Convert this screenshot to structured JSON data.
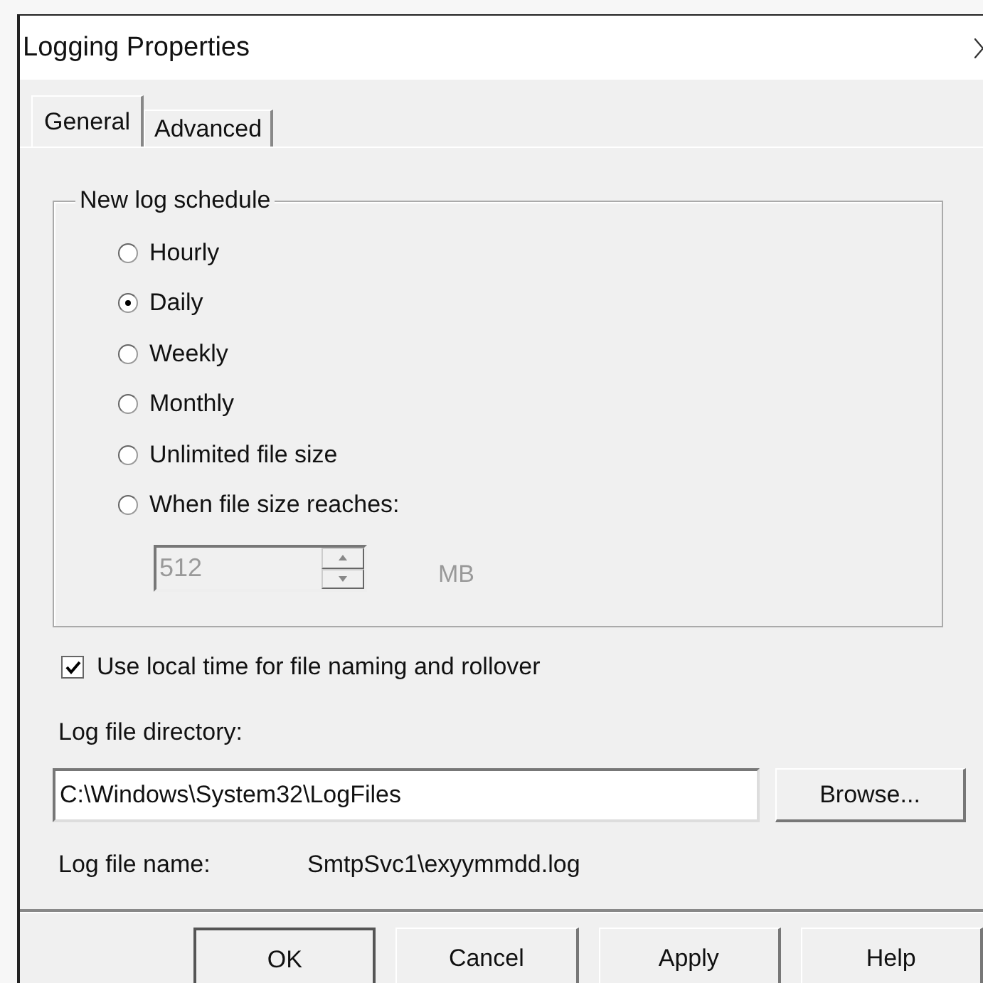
{
  "window": {
    "title": "Logging Properties"
  },
  "tabs": [
    {
      "label": "General",
      "selected": true
    },
    {
      "label": "Advanced",
      "selected": false
    }
  ],
  "schedule": {
    "title": "New log schedule",
    "options": [
      {
        "label": "Hourly",
        "selected": false
      },
      {
        "label": "Daily",
        "selected": true
      },
      {
        "label": "Weekly",
        "selected": false
      },
      {
        "label": "Monthly",
        "selected": false
      },
      {
        "label": "Unlimited file size",
        "selected": false
      },
      {
        "label": "When file size reaches:",
        "selected": false
      }
    ],
    "size": {
      "value": "512",
      "unit": "MB",
      "disabled": true
    }
  },
  "local_time": {
    "label": "Use local time for file naming and rollover",
    "checked": true
  },
  "directory": {
    "label": "Log file directory:",
    "value": "C:\\Windows\\System32\\LogFiles",
    "browse": "Browse..."
  },
  "file_name": {
    "label": "Log file name:",
    "value": "SmtpSvc1\\exyymmdd.log"
  },
  "buttons": [
    "OK",
    "Cancel",
    "Apply",
    "Help"
  ]
}
